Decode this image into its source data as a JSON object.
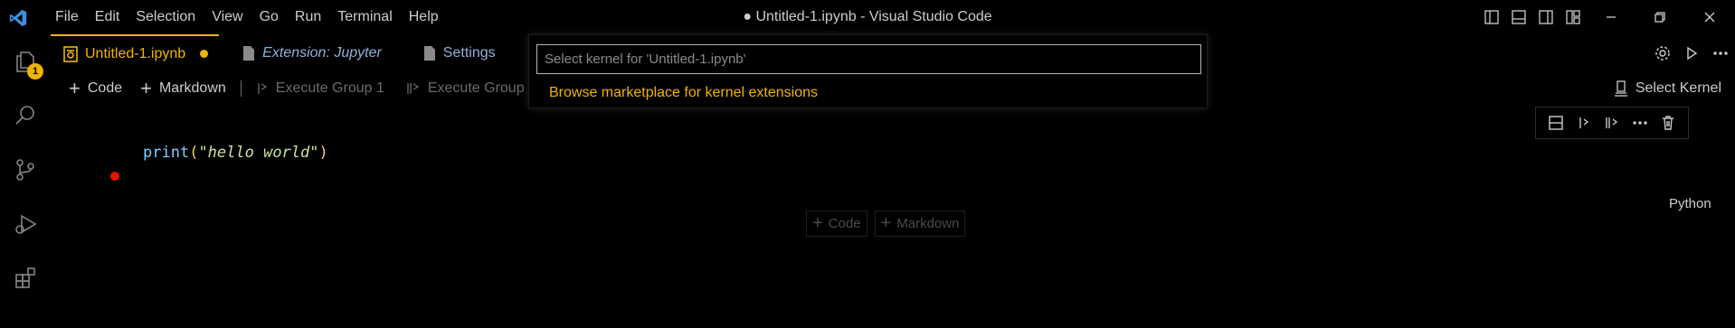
{
  "titlebar": {
    "menu": [
      "File",
      "Edit",
      "Selection",
      "View",
      "Go",
      "Run",
      "Terminal",
      "Help"
    ],
    "window_title": "● Untitled-1.ipynb - Visual Studio Code"
  },
  "activitybar": {
    "explorer_badge": "1"
  },
  "tabs": [
    {
      "label": "Untitled-1.ipynb",
      "icon": "notebook-icon"
    },
    {
      "label": "Extension: Jupyter",
      "icon": "file-icon"
    },
    {
      "label": "Settings",
      "icon": "file-icon"
    }
  ],
  "toolbar": {
    "add_code": "Code",
    "add_markdown": "Markdown",
    "execute_group_1": "Execute Group 1",
    "execute_group_2": "Execute Group",
    "select_kernel": "Select Kernel"
  },
  "cell": {
    "code_fn": "print",
    "code_open": "(",
    "code_str": "\"hello world\"",
    "code_close": ")",
    "language": "Python"
  },
  "insert": {
    "code": "Code",
    "markdown": "Markdown"
  },
  "quickpick": {
    "placeholder": "Select kernel for 'Untitled-1.ipynb'",
    "item": "Browse marketplace for kernel extensions"
  },
  "colors": {
    "accent": "#f0b400",
    "error_dot": "#e51400",
    "background": "#000000"
  }
}
